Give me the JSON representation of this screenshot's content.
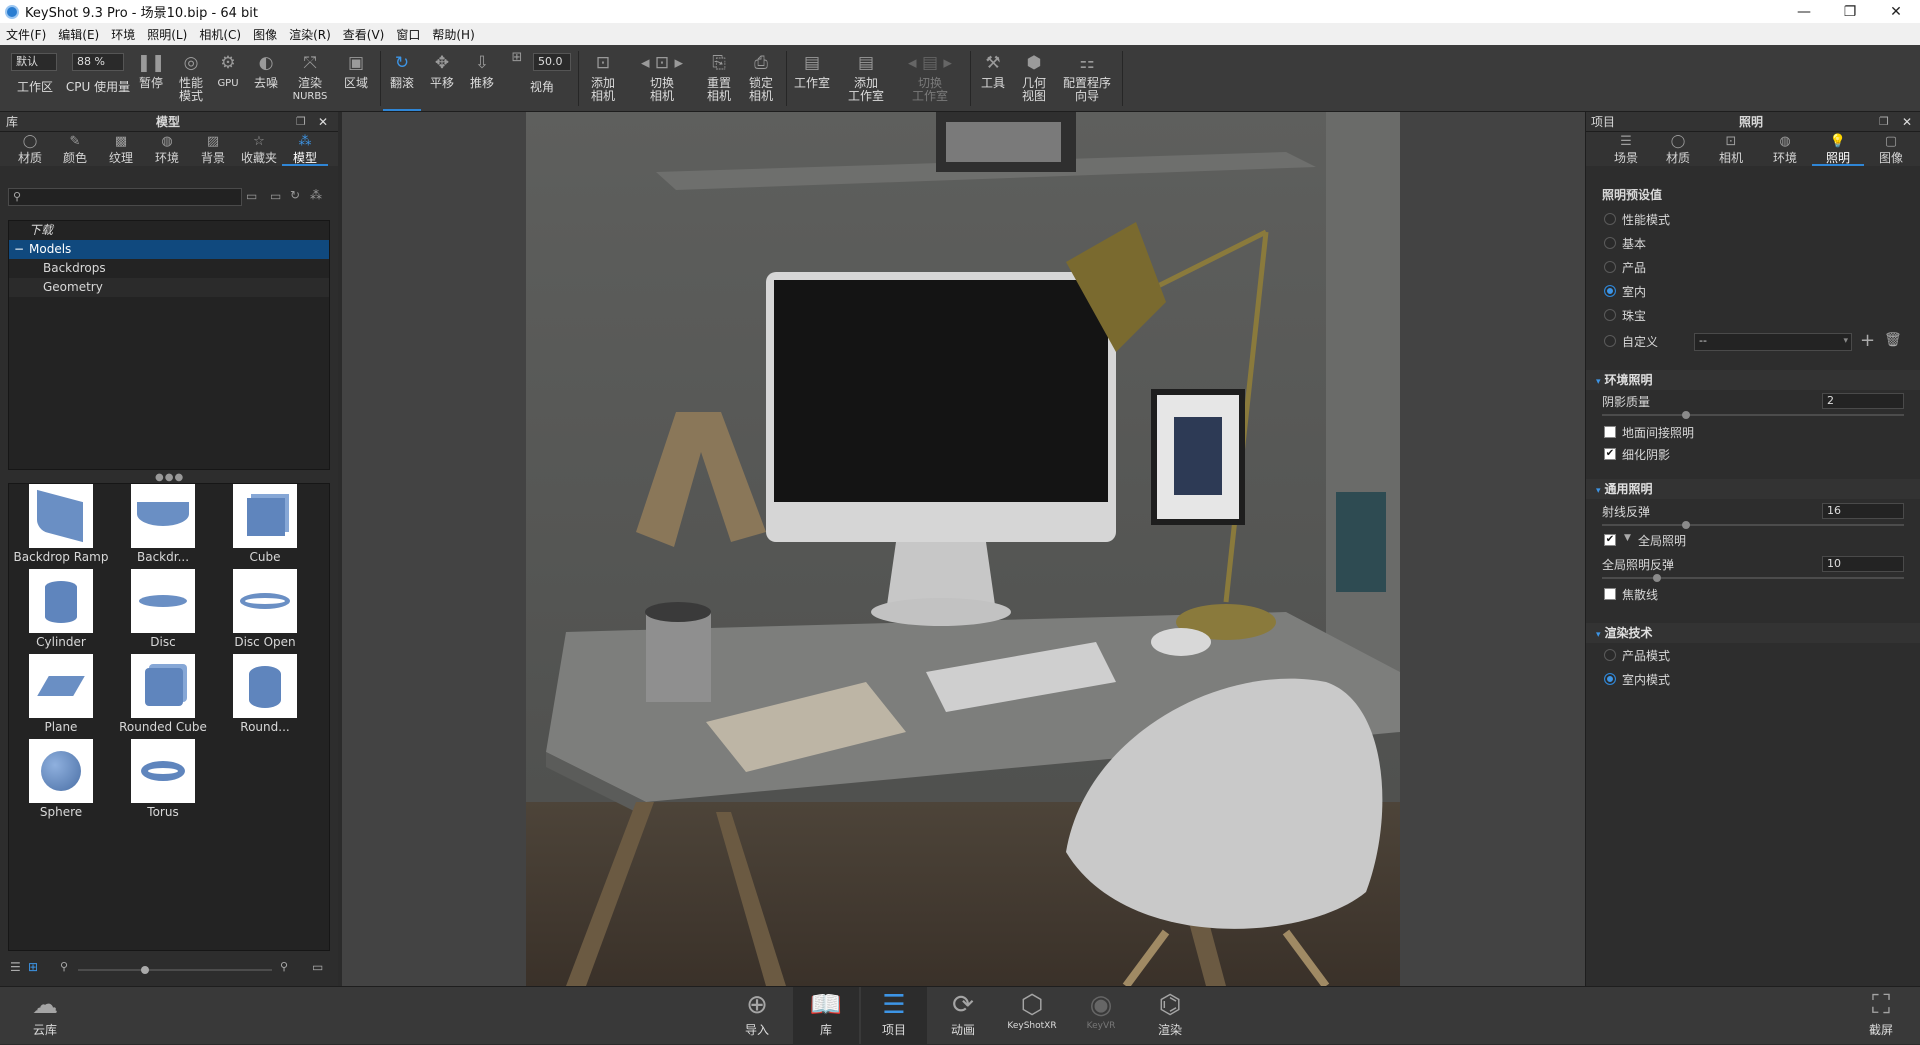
{
  "window": {
    "title": "KeyShot 9.3 Pro  - 场景10.bip  - 64 bit",
    "controls": {
      "minimize": "—",
      "restore": "❐",
      "close": "✕"
    }
  },
  "menu": [
    "文件(F)",
    "编辑(E)",
    "环境",
    "照明(L)",
    "相机(C)",
    "图像",
    "渲染(R)",
    "查看(V)",
    "窗口",
    "帮助(H)"
  ],
  "toolbar": {
    "workspace_value": "默认",
    "workspace_label": "工作区",
    "cpu_value": "88 %",
    "cpu_label": "CPU 使用量",
    "pause": "暂停",
    "perf_mode": "性能\n模式",
    "gpu": "GPU",
    "denoise": "去噪",
    "nurbs_top": "渲染",
    "nurbs_bottom": "NURBS",
    "region": "区域",
    "tumble": "翻滚",
    "pan": "平移",
    "dolly": "推移",
    "fov_value": "50.0",
    "fov_label": "视角",
    "add_camera": "添加\n相机",
    "switch_camera": "切换\n相机",
    "reset_camera": "重置\n相机",
    "lock_camera": "锁定\n相机",
    "studio": "工作室",
    "add_studio": "添加\n工作室",
    "switch_studio": "切换\n工作室",
    "tools": "工具",
    "geometry_view": "几何\n视图",
    "config_wizard": "配置程序\n向导"
  },
  "library": {
    "header_left": "库",
    "header_title": "模型",
    "tabs": [
      "材质",
      "颜色",
      "纹理",
      "环境",
      "背景",
      "收藏夹",
      "模型"
    ],
    "active_tab": 6,
    "search_placeholder": "",
    "tree": [
      {
        "label": "下载",
        "italic": true,
        "depth": 0
      },
      {
        "label": "Models",
        "selected": true,
        "depth": 0,
        "toggle": "−"
      },
      {
        "label": "Backdrops",
        "depth": 1
      },
      {
        "label": "Geometry",
        "depth": 1
      }
    ],
    "models": [
      "Backdrop Ramp",
      "Backdr...",
      "Cube",
      "Cylinder",
      "Disc",
      "Disc Open",
      "Plane",
      "Rounded Cube",
      "Round...",
      "Sphere",
      "Torus"
    ]
  },
  "project": {
    "header_left": "项目",
    "header_title": "照明",
    "tabs": [
      "场景",
      "材质",
      "相机",
      "环境",
      "照明",
      "图像"
    ],
    "active_tab": 4,
    "presets_title": "照明预设值",
    "presets": [
      "性能模式",
      "基本",
      "产品",
      "室内",
      "珠宝",
      "自定义"
    ],
    "selected_preset": 3,
    "custom_dropdown": "--",
    "env_section": "环境照明",
    "shadow_quality_label": "阴影质量",
    "shadow_quality_value": "2",
    "ground_indirect_label": "地面间接照明",
    "ground_indirect_checked": false,
    "refine_shadows_label": "细化阴影",
    "refine_shadows_checked": true,
    "general_section": "通用照明",
    "ray_bounces_label": "射线反弹",
    "ray_bounces_value": "16",
    "gi_label": "全局照明",
    "gi_checked": true,
    "gi_bounces_label": "全局照明反弹",
    "gi_bounces_value": "10",
    "caustics_label": "焦散线",
    "caustics_checked": false,
    "render_section": "渲染技术",
    "render_modes": [
      "产品模式",
      "室内模式"
    ],
    "selected_render_mode": 1
  },
  "bottom": {
    "cloud": "云库",
    "import": "导入",
    "library": "库",
    "project": "项目",
    "animation": "动画",
    "keyshotxr": "KeyShotXR",
    "keyvr": "KeyVR",
    "render": "渲染",
    "screenshot": "截屏"
  }
}
